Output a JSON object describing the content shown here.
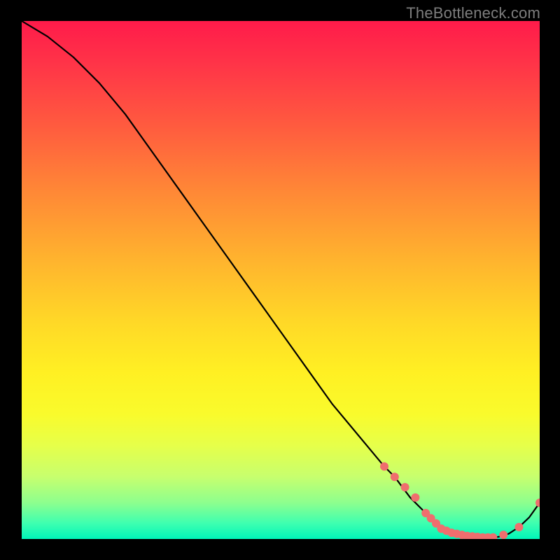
{
  "watermark": "TheBottleneck.com",
  "chart_data": {
    "type": "line",
    "title": "",
    "xlabel": "",
    "ylabel": "",
    "xlim": [
      0,
      100
    ],
    "ylim": [
      0,
      100
    ],
    "grid": false,
    "legend": false,
    "series": [
      {
        "name": "curve",
        "color": "#000000",
        "x": [
          0,
          5,
          10,
          15,
          20,
          25,
          30,
          35,
          40,
          45,
          50,
          55,
          60,
          65,
          70,
          72,
          75,
          78,
          80,
          82,
          85,
          88,
          90,
          92,
          94,
          96,
          98,
          100
        ],
        "y": [
          100,
          97,
          93,
          88,
          82,
          75,
          68,
          61,
          54,
          47,
          40,
          33,
          26,
          20,
          14,
          12,
          8,
          5,
          3,
          2,
          1,
          0.5,
          0.3,
          0.4,
          1.0,
          2.3,
          4.2,
          7
        ]
      }
    ],
    "markers": [
      {
        "name": "dots",
        "color": "#ef6e6e",
        "radius_px": 6,
        "x": [
          70,
          72,
          74,
          76,
          78,
          79,
          80,
          81,
          82,
          83,
          84,
          85,
          86,
          87,
          88,
          89,
          90,
          91,
          93,
          96,
          100
        ],
        "y": [
          14,
          12,
          10,
          8,
          5,
          4,
          3,
          2,
          1.6,
          1.2,
          1.0,
          0.8,
          0.6,
          0.5,
          0.4,
          0.3,
          0.3,
          0.3,
          0.8,
          2.3,
          7
        ]
      }
    ]
  }
}
